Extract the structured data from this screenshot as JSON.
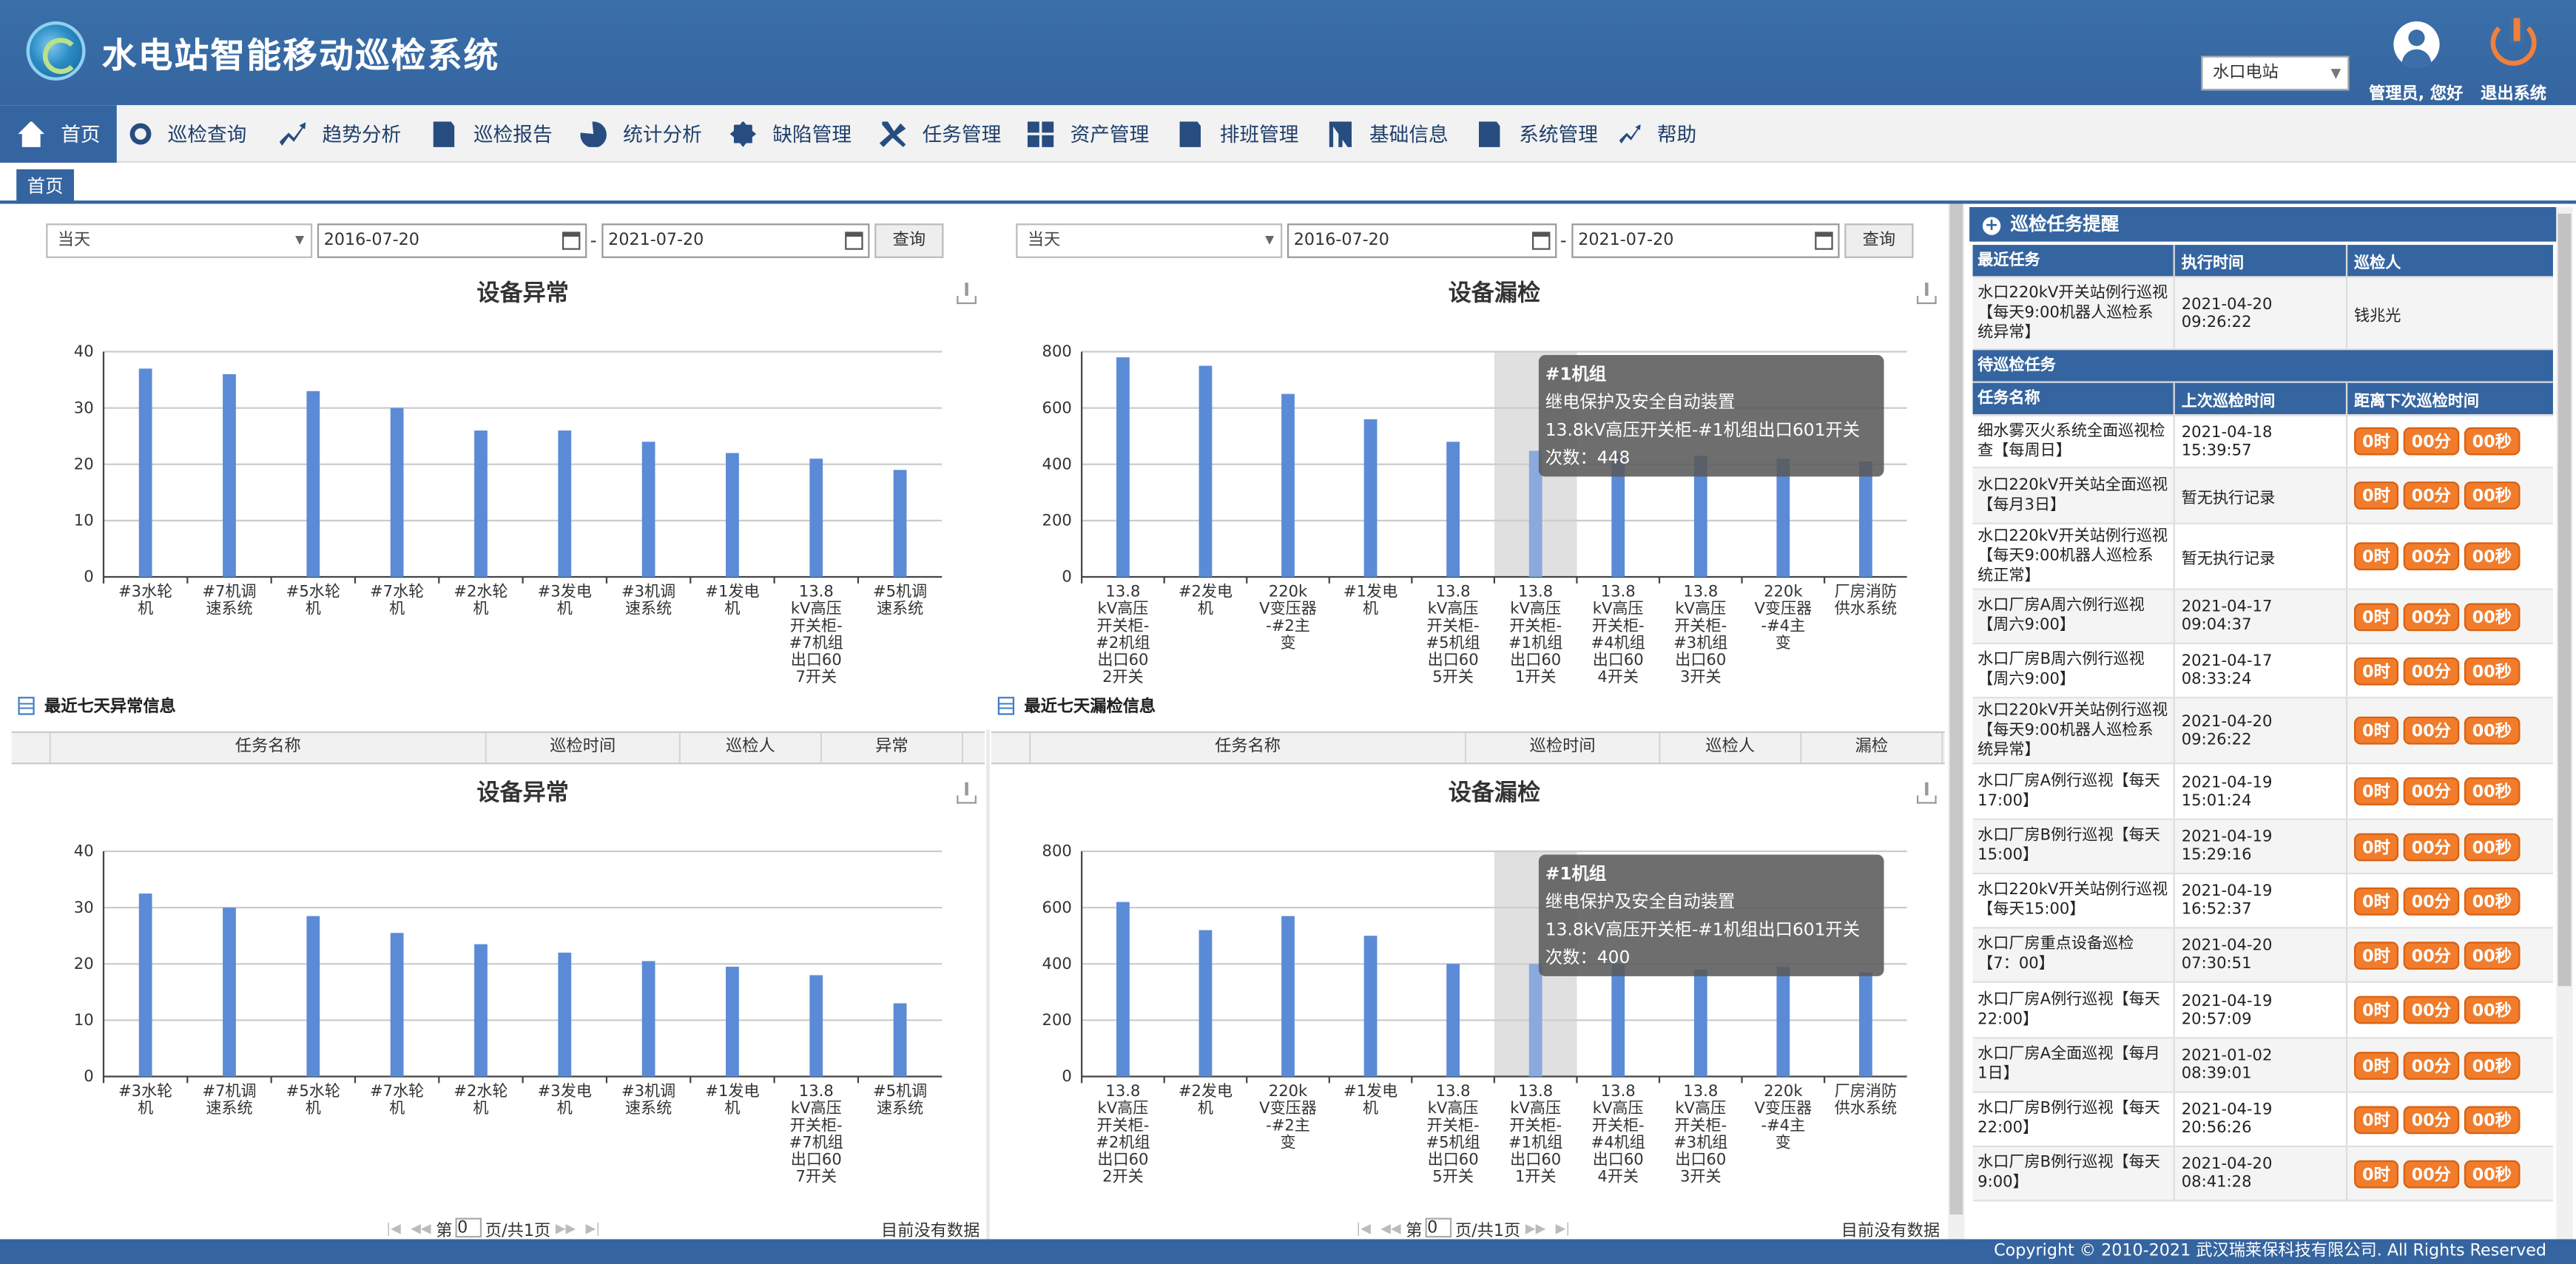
{
  "header": {
    "title": "水电站智能移动巡检系统",
    "station_select": "水口电站",
    "user_label": "管理员, 您好",
    "logout_label": "退出系统"
  },
  "nav": {
    "items": [
      {
        "label": "首页",
        "icon": "home-icon"
      },
      {
        "label": "巡检查询",
        "icon": "search-icon"
      },
      {
        "label": "趋势分析",
        "icon": "trend-icon"
      },
      {
        "label": "巡检报告",
        "icon": "report-icon"
      },
      {
        "label": "统计分析",
        "icon": "pie-chart-icon"
      },
      {
        "label": "缺陷管理",
        "icon": "gear-icon"
      },
      {
        "label": "任务管理",
        "icon": "tools-icon"
      },
      {
        "label": "资产管理",
        "icon": "grid-icon"
      },
      {
        "label": "排班管理",
        "icon": "schedule-icon"
      },
      {
        "label": "基础信息",
        "icon": "sliders-icon"
      },
      {
        "label": "系统管理",
        "icon": "settings-doc-icon"
      },
      {
        "label": "帮助",
        "icon": "help-icon"
      }
    ]
  },
  "tabs": {
    "home": "首页"
  },
  "filters": {
    "left": {
      "range": "当天",
      "start": "2016-07-20",
      "end": "2021-07-20",
      "query": "查询",
      "dash": "-"
    },
    "right": {
      "range": "当天",
      "start": "2016-07-20",
      "end": "2021-07-20",
      "query": "查询",
      "dash": "-"
    }
  },
  "sections": {
    "left_title": "最近七天异常信息",
    "right_title": "最近七天漏检信息",
    "left_cols": [
      "任务名称",
      "巡检时间",
      "巡检人",
      "异常"
    ],
    "right_cols": [
      "任务名称",
      "巡检时间",
      "巡检人",
      "漏检"
    ],
    "pager_prefix": "第",
    "pager_page": "0",
    "pager_suffix": "页/共1页",
    "no_data": "目前没有数据"
  },
  "chart_data": [
    {
      "type": "bar",
      "title": "设备异常",
      "categories": [
        "#3水轮机",
        "#7机调速系统",
        "#5水轮机",
        "#7水轮机",
        "#2水轮机",
        "#3发电机",
        "#3机调速系统",
        "#1发电机",
        "13.8kV高压开关柜-#7机组出口607开关",
        "#5机调速系统"
      ],
      "values": [
        37,
        36,
        33,
        30,
        26,
        26,
        24,
        22,
        21,
        19
      ],
      "ylim": [
        0,
        40
      ],
      "yticks": [
        0,
        10,
        20,
        30,
        40
      ],
      "color": "#5b8bd6"
    },
    {
      "type": "bar",
      "title": "设备漏检",
      "categories": [
        "13.8kV高压开关柜-#2机组出口602开关",
        "#2发电机",
        "220kV变压器-#2主变",
        "#1发电机",
        "13.8kV高压开关柜-#5机组出口605开关",
        "13.8kV高压开关柜-#1机组出口601开关",
        "13.8kV高压开关柜-#4机组出口604开关",
        "13.8kV高压开关柜-#3机组出口603开关",
        "220kV变压器-#4主变",
        "厂房消防供水系统"
      ],
      "values": [
        780,
        750,
        650,
        560,
        480,
        448,
        440,
        430,
        420,
        410
      ],
      "ylim": [
        0,
        800
      ],
      "yticks": [
        0,
        200,
        400,
        600,
        800
      ],
      "highlight_index": 5,
      "tooltip": [
        "#1机组",
        "继电保护及安全自动装置",
        "13.8kV高压开关柜-#1机组出口601开关",
        "次数：448"
      ],
      "color": "#5b8bd6"
    },
    {
      "type": "bar",
      "title": "设备异常",
      "categories": [
        "#3水轮机",
        "#7机调速系统",
        "#5水轮机",
        "#7水轮机",
        "#2水轮机",
        "#3发电机",
        "#3机调速系统",
        "#1发电机",
        "13.8kV高压开关柜-#7机组出口607开关",
        "#5机调速系统"
      ],
      "values": [
        32.5,
        30,
        28.5,
        25.5,
        23.5,
        22,
        20.5,
        19.5,
        18,
        13
      ],
      "ylim": [
        0,
        40
      ],
      "yticks": [
        0,
        10,
        20,
        30,
        40
      ],
      "color": "#5b8bd6"
    },
    {
      "type": "bar",
      "title": "设备漏检",
      "categories": [
        "13.8kV高压开关柜-#2机组出口602开关",
        "#2发电机",
        "220kV变压器-#2主变",
        "#1发电机",
        "13.8kV高压开关柜-#5机组出口605开关",
        "13.8kV高压开关柜-#1机组出口601开关",
        "13.8kV高压开关柜-#4机组出口604开关",
        "13.8kV高压开关柜-#3机组出口603开关",
        "220kV变压器-#4主变",
        "厂房消防供水系统"
      ],
      "values": [
        620,
        520,
        570,
        500,
        400,
        400,
        400,
        380,
        390,
        370
      ],
      "ylim": [
        0,
        800
      ],
      "yticks": [
        0,
        200,
        400,
        600,
        800
      ],
      "highlight_index": 5,
      "tooltip": [
        "#1机组",
        "继电保护及安全自动装置",
        "13.8kV高压开关柜-#1机组出口601开关",
        "次数：400"
      ],
      "color": "#5b8bd6"
    }
  ],
  "right_panel": {
    "title": "巡检任务提醒",
    "recent_headers": [
      "最近任务",
      "执行时间",
      "巡检人"
    ],
    "recent_rows": [
      {
        "name": "水口220kV开关站例行巡视【每天9:00机器人巡检系统异常】",
        "time": "2021-04-20 09:26:22",
        "person": "钱兆光"
      }
    ],
    "pending_title": "待巡检任务",
    "pending_headers": [
      "任务名称",
      "上次巡检时间",
      "距离下次巡检时间"
    ],
    "pending_rows": [
      {
        "name": "细水雾灭火系统全面巡视检查【每周日】",
        "time": "2021-04-18 15:39:57"
      },
      {
        "name": "水口220kV开关站全面巡视【每月3日】",
        "time": "暂无执行记录"
      },
      {
        "name": "水口220kV开关站例行巡视【每天9:00机器人巡检系统正常】",
        "time": "暂无执行记录"
      },
      {
        "name": "水口厂房A周六例行巡视【周六9:00】",
        "time": "2021-04-17 09:04:37"
      },
      {
        "name": "水口厂房B周六例行巡视【周六9:00】",
        "time": "2021-04-17 08:33:24"
      },
      {
        "name": "水口220kV开关站例行巡视【每天9:00机器人巡检系统异常】",
        "time": "2021-04-20 09:26:22"
      },
      {
        "name": "水口厂房A例行巡视【每天17:00】",
        "time": "2021-04-19 15:01:24"
      },
      {
        "name": "水口厂房B例行巡视【每天15:00】",
        "time": "2021-04-19 15:29:16"
      },
      {
        "name": "水口220kV开关站例行巡视【每天15:00】",
        "time": "2021-04-19 16:52:37"
      },
      {
        "name": "水口厂房重点设备巡检【7：00】",
        "time": "2021-04-20 07:30:51"
      },
      {
        "name": "水口厂房A例行巡视【每天22:00】",
        "time": "2021-04-19 20:57:09"
      },
      {
        "name": "水口厂房A全面巡视【每月1日】",
        "time": "2021-01-02 08:39:01"
      },
      {
        "name": "水口厂房B例行巡视【每天22:00】",
        "time": "2021-04-19 20:56:26"
      },
      {
        "name": "水口厂房B例行巡视【每天9:00】",
        "time": "2021-04-20 08:41:28"
      }
    ],
    "countdown": {
      "h": "0时",
      "m": "00分",
      "s": "00秒"
    }
  },
  "footer": "Copyright © 2010-2021 武汉瑞莱保科技有限公司. All Rights Reserved"
}
